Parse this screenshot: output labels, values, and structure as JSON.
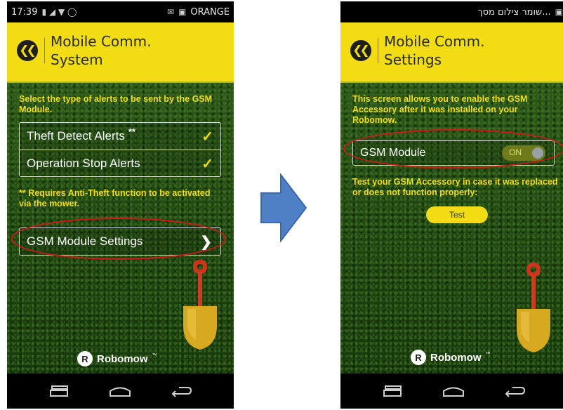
{
  "left_screen": {
    "status_bar": {
      "time": "17:39",
      "carrier": "ORANGE"
    },
    "header": {
      "title_line1": "Mobile Comm.",
      "title_line2": "System",
      "back_icon": "double-chevron-left-icon"
    },
    "description": "Select the type of alerts to be sent by the GSM Module.",
    "alert_options": [
      {
        "label": "Theft Detect Alerts",
        "stars": "**",
        "checked": true
      },
      {
        "label": "Operation Stop Alerts",
        "checked": true
      }
    ],
    "note_stars": "**",
    "note_text": " Requires Anti-Theft function to be activated via the mower.",
    "settings_link": {
      "label": "GSM Module Settings",
      "icon": "chevron-right-icon"
    },
    "logo": {
      "badge": "R",
      "text": "Robomow",
      "tm": "™"
    }
  },
  "right_screen": {
    "status_bar": {
      "notification_text": "...שומר צילום מסך"
    },
    "header": {
      "title_line1": "Mobile Comm.",
      "title_line2": "Settings",
      "back_icon": "double-chevron-left-icon"
    },
    "description": "This screen allows you to enable the GSM Accessory after it was installed on your Robomow.",
    "gsm_toggle": {
      "label": "GSM Module",
      "state_label": "ON",
      "on": true
    },
    "test_description": "Test your GSM Accessory in case it was replaced or does not function properly:",
    "test_button": "Test",
    "logo": {
      "badge": "R",
      "text": "Robomow",
      "tm": "™"
    }
  },
  "colors": {
    "accent_yellow": "#f2dc13",
    "background_green": "#254c14",
    "highlight_red": "#d21a1a",
    "flow_arrow_blue": "#4f7fc4"
  },
  "icons": [
    "double-chevron-left-icon",
    "check-icon",
    "chevron-right-icon",
    "shovel-icon",
    "recent-apps-icon",
    "home-icon",
    "back-icon",
    "arrow-right-icon"
  ]
}
